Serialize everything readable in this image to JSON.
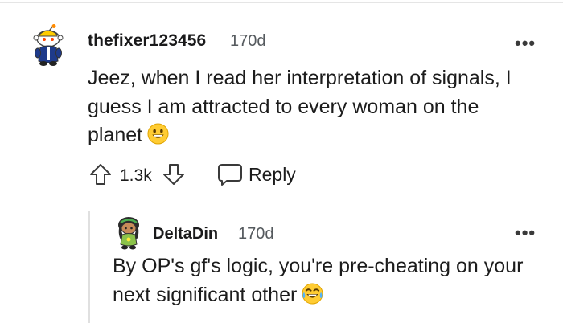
{
  "thread": {
    "comment": {
      "username": "thefixer123456",
      "age": "170d",
      "menu": "•••",
      "body": "Jeez, when I read her interpretation of signals, I guess I am attracted to every woman on the planet",
      "emoji": "grinning-face-emoji",
      "score": "1.3k",
      "reply_label": "Reply"
    },
    "reply": {
      "username": "DeltaDin",
      "age": "170d",
      "menu": "•••",
      "body": "By OP's gf's logic, you're pre-cheating on your next significant other",
      "emoji": "tears-of-joy-emoji"
    }
  },
  "icons": {
    "upvote": "arrow-up-icon",
    "downvote": "arrow-down-icon",
    "reply": "speech-bubble-icon",
    "more": "more-horizontal-icon"
  },
  "colors": {
    "text": "#1c1c1c",
    "meta": "#555a5e",
    "thread_line": "#e0e0e0",
    "emoji_face": "#ffcc33"
  }
}
